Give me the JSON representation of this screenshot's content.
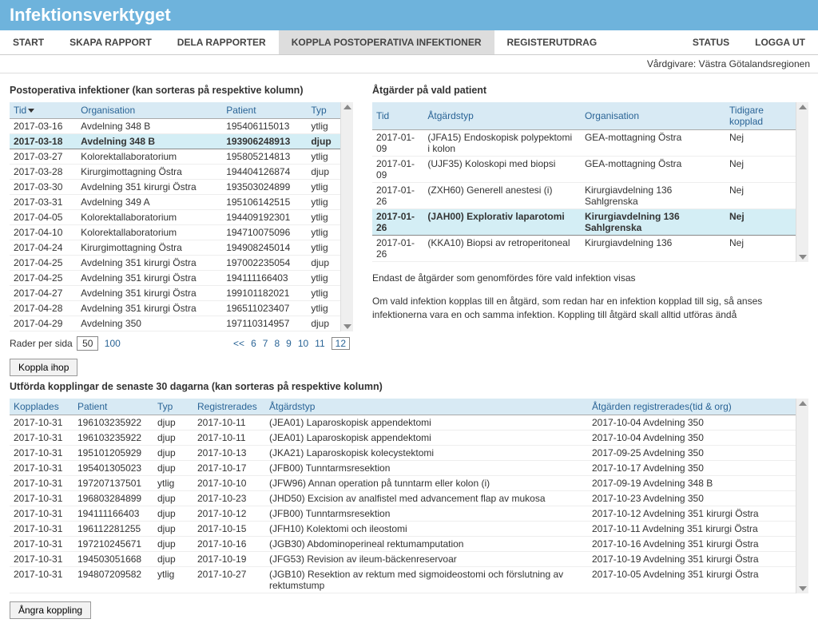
{
  "app": {
    "title": "Infektionsverktyget"
  },
  "nav": {
    "items": [
      {
        "label": "START"
      },
      {
        "label": "SKAPA RAPPORT"
      },
      {
        "label": "DELA RAPPORTER"
      },
      {
        "label": "KOPPLA POSTOPERATIVA INFEKTIONER"
      },
      {
        "label": "REGISTERUTDRAG"
      }
    ],
    "right": [
      {
        "label": "STATUS"
      },
      {
        "label": "LOGGA UT"
      }
    ]
  },
  "subheader": "Vårdgivare: Västra Götalandsregionen",
  "left": {
    "title": "Postoperativa infektioner (kan sorteras på respektive kolumn)",
    "cols": {
      "c0": "Tid",
      "c1": "Organisation",
      "c2": "Patient",
      "c3": "Typ"
    },
    "rows": [
      {
        "c0": "2017-03-16",
        "c1": "Avdelning 348 B",
        "c2": "195406115013",
        "c3": "ytlig"
      },
      {
        "c0": "2017-03-18",
        "c1": "Avdelning 348 B",
        "c2": "193906248913",
        "c3": "djup"
      },
      {
        "c0": "2017-03-27",
        "c1": "Kolorektallaboratorium",
        "c2": "195805214813",
        "c3": "ytlig"
      },
      {
        "c0": "2017-03-28",
        "c1": "Kirurgimottagning Östra",
        "c2": "194404126874",
        "c3": "djup"
      },
      {
        "c0": "2017-03-30",
        "c1": "Avdelning 351 kirurgi Östra",
        "c2": "193503024899",
        "c3": "ytlig"
      },
      {
        "c0": "2017-03-31",
        "c1": "Avdelning 349 A",
        "c2": "195106142515",
        "c3": "ytlig"
      },
      {
        "c0": "2017-04-05",
        "c1": "Kolorektallaboratorium",
        "c2": "194409192301",
        "c3": "ytlig"
      },
      {
        "c0": "2017-04-10",
        "c1": "Kolorektallaboratorium",
        "c2": "194710075096",
        "c3": "ytlig"
      },
      {
        "c0": "2017-04-24",
        "c1": "Kirurgimottagning Östra",
        "c2": "194908245014",
        "c3": "ytlig"
      },
      {
        "c0": "2017-04-25",
        "c1": "Avdelning 351 kirurgi Östra",
        "c2": "197002235054",
        "c3": "djup"
      },
      {
        "c0": "2017-04-25",
        "c1": "Avdelning 351 kirurgi Östra",
        "c2": "194111166403",
        "c3": "ytlig"
      },
      {
        "c0": "2017-04-27",
        "c1": "Avdelning 351 kirurgi Östra",
        "c2": "199101182021",
        "c3": "ytlig"
      },
      {
        "c0": "2017-04-28",
        "c1": "Avdelning 351 kirurgi Östra",
        "c2": "196511023407",
        "c3": "ytlig"
      },
      {
        "c0": "2017-04-29",
        "c1": "Avdelning 350",
        "c2": "197110314957",
        "c3": "djup"
      }
    ],
    "selectedIndex": 1,
    "rowsPerPageLabel": "Rader per sida",
    "rowsPerPageCurrent": "50",
    "rowsPerPageOther": "100",
    "pages": [
      "<<",
      "6",
      "7",
      "8",
      "9",
      "10",
      "11",
      "12"
    ],
    "currentPage": "12"
  },
  "right": {
    "title": "Åtgärder på vald patient",
    "cols": {
      "c0": "Tid",
      "c1": "Åtgärdstyp",
      "c2": "Organisation",
      "c3": "Tidigare kopplad"
    },
    "rows": [
      {
        "c0": "2017-01-09",
        "c1": "(JFA15) Endoskopisk polypektomi i kolon",
        "c2": "GEA-mottagning Östra",
        "c3": "Nej"
      },
      {
        "c0": "2017-01-09",
        "c1": "(UJF35) Koloskopi med biopsi",
        "c2": "GEA-mottagning Östra",
        "c3": "Nej"
      },
      {
        "c0": "2017-01-26",
        "c1": "(ZXH60) Generell anestesi (i)",
        "c2": "Kirurgiavdelning 136 Sahlgrenska",
        "c3": "Nej"
      },
      {
        "c0": "2017-01-26",
        "c1": "(JAH00) Explorativ laparotomi",
        "c2": "Kirurgiavdelning 136 Sahlgrenska",
        "c3": "Nej"
      },
      {
        "c0": "2017-01-26",
        "c1": "(KKA10) Biopsi av retroperitoneal",
        "c2": "Kirurgiavdelning 136",
        "c3": "Nej"
      }
    ],
    "selectedIndex": 3,
    "help1": "Endast de åtgärder som genomfördes före vald infektion visas",
    "help2": "Om vald infektion kopplas till en åtgärd, som redan har en infektion kopplad till sig, så anses infektionerna vara en och samma infektion. Koppling till åtgärd skall alltid utföras ändå"
  },
  "buttons": {
    "koppla": "Koppla ihop",
    "angra": "Ångra koppling"
  },
  "bottom": {
    "title": "Utförda kopplingar de senaste 30 dagarna (kan sorteras på respektive kolumn)",
    "cols": {
      "c0": "Kopplades",
      "c1": "Patient",
      "c2": "Typ",
      "c3": "Registrerades",
      "c4": "Åtgärdstyp",
      "c5": "Åtgärden registrerades(tid & org)"
    },
    "rows": [
      {
        "c0": "2017-10-31",
        "c1": "196103235922",
        "c2": "djup",
        "c3": "2017-10-11",
        "c4": "(JEA01) Laparoskopisk appendektomi",
        "c5": "2017-10-04 Avdelning 350"
      },
      {
        "c0": "2017-10-31",
        "c1": "196103235922",
        "c2": "djup",
        "c3": "2017-10-11",
        "c4": "(JEA01) Laparoskopisk appendektomi",
        "c5": "2017-10-04 Avdelning 350"
      },
      {
        "c0": "2017-10-31",
        "c1": "195101205929",
        "c2": "djup",
        "c3": "2017-10-13",
        "c4": "(JKA21) Laparoskopisk kolecystektomi",
        "c5": "2017-09-25 Avdelning 350"
      },
      {
        "c0": "2017-10-31",
        "c1": "195401305023",
        "c2": "djup",
        "c3": "2017-10-17",
        "c4": "(JFB00) Tunntarmsresektion",
        "c5": "2017-10-17 Avdelning 350"
      },
      {
        "c0": "2017-10-31",
        "c1": "197207137501",
        "c2": "ytlig",
        "c3": "2017-10-10",
        "c4": "(JFW96) Annan operation på tunntarm eller kolon (i)",
        "c5": "2017-09-19 Avdelning 348 B"
      },
      {
        "c0": "2017-10-31",
        "c1": "196803284899",
        "c2": "djup",
        "c3": "2017-10-23",
        "c4": "(JHD50) Excision av analfistel med advancement flap av mukosa",
        "c5": "2017-10-23 Avdelning 350"
      },
      {
        "c0": "2017-10-31",
        "c1": "194111166403",
        "c2": "djup",
        "c3": "2017-10-12",
        "c4": "(JFB00) Tunntarmsresektion",
        "c5": "2017-10-12 Avdelning 351 kirurgi Östra"
      },
      {
        "c0": "2017-10-31",
        "c1": "196112281255",
        "c2": "djup",
        "c3": "2017-10-15",
        "c4": "(JFH10) Kolektomi och ileostomi",
        "c5": "2017-10-11 Avdelning 351 kirurgi Östra"
      },
      {
        "c0": "2017-10-31",
        "c1": "197210245671",
        "c2": "djup",
        "c3": "2017-10-16",
        "c4": "(JGB30) Abdominoperineal rektumamputation",
        "c5": "2017-10-16 Avdelning 351 kirurgi Östra"
      },
      {
        "c0": "2017-10-31",
        "c1": "194503051668",
        "c2": "djup",
        "c3": "2017-10-19",
        "c4": "(JFG53) Revision av ileum-bäckenreservoar",
        "c5": "2017-10-19 Avdelning 351 kirurgi Östra"
      },
      {
        "c0": "2017-10-31",
        "c1": "194807209582",
        "c2": "ytlig",
        "c3": "2017-10-27",
        "c4": "(JGB10) Resektion av rektum med sigmoideostomi och förslutning av rektumstump",
        "c5": "2017-10-05 Avdelning 351 kirurgi Östra"
      }
    ]
  }
}
